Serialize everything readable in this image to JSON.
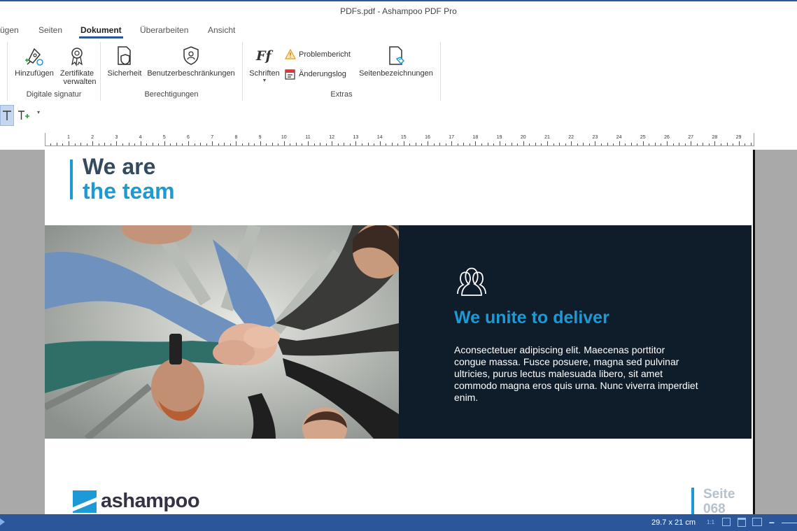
{
  "window": {
    "title": "PDFs.pdf - Ashampoo PDF Pro"
  },
  "tabs": [
    {
      "label": "ügen"
    },
    {
      "label": "Seiten"
    },
    {
      "label": "Dokument"
    },
    {
      "label": "Überarbeiten"
    },
    {
      "label": "Ansicht"
    }
  ],
  "ribbon": {
    "hinzufuegen": "Hinzufügen",
    "zertifikate_line1": "Zertifikate",
    "zertifikate_line2": "verwalten",
    "group_digitale": "Digitale signatur",
    "sicherheit": "Sicherheit",
    "benutzer": "Benutzerbeschränkungen",
    "group_berechtigungen": "Berechtigungen",
    "schriften": "Schriften",
    "problembericht": "Problembericht",
    "aenderungslog": "Änderungslog",
    "seitenbezeichnungen": "Seitenbezeichnungen",
    "group_extras": "Extras"
  },
  "ruler": {
    "labels": [
      "1",
      "2",
      "3",
      "4",
      "5",
      "6",
      "7",
      "8",
      "9",
      "10",
      "11",
      "12",
      "13",
      "14",
      "15",
      "16",
      "17",
      "18",
      "19",
      "20",
      "21",
      "22",
      "23",
      "24",
      "25",
      "26",
      "27",
      "28",
      "29"
    ]
  },
  "page": {
    "heading_line1": "We are",
    "heading_line2": "the team",
    "panel_title": "We unite to deliver",
    "panel_body": "Aconsectetuer adipiscing elit. Maecenas porttitor congue massa. Fusce posuere, magna sed pulvinar ultricies, purus lectus malesuada libero, sit amet commodo magna eros quis urna. Nunc viverra imperdiet enim.",
    "logo_text": "ashampoo",
    "page_label": "Seite",
    "page_number": "068"
  },
  "status": {
    "page_size": "29.7 x 21 cm",
    "zoom_ratio": "1:1",
    "zoom_out": "–"
  },
  "colors": {
    "accent": "#1c9ad6",
    "dark_panel": "#0f1c2a",
    "status_bar": "#2b579a",
    "heading": "#354a5f"
  }
}
